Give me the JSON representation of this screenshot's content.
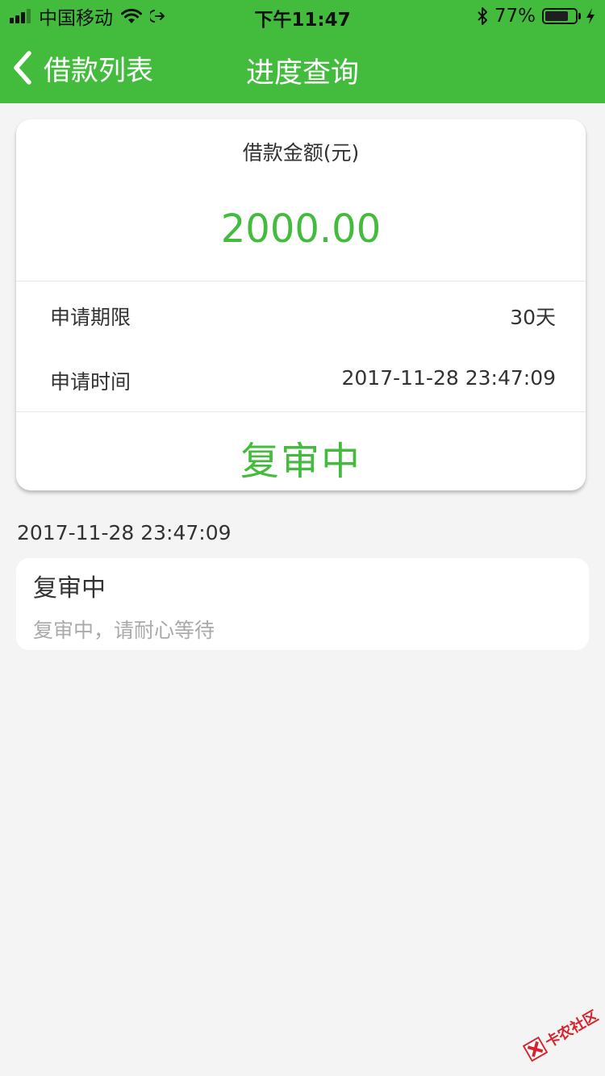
{
  "status_bar": {
    "carrier": "中国移动",
    "time": "下午11:47",
    "battery_percent": "77%",
    "battery_level": 0.77,
    "signal_bars_filled": 3,
    "signal_bars_total": 4,
    "icons": [
      "signal-icon",
      "wifi-icon",
      "location-arrow-icon",
      "bluetooth-icon",
      "battery-icon",
      "charging-bolt-icon"
    ]
  },
  "nav": {
    "back_label": "借款列表",
    "title": "进度查询",
    "back_icon": "chevron-left-icon"
  },
  "summary": {
    "amount_label": "借款金额(元)",
    "amount_value": "2000.00",
    "term_label": "申请期限",
    "term_value": "30天",
    "time_label": "申请时间",
    "time_value": "2017-11-28 23:47:09",
    "status": "复审中"
  },
  "timeline": [
    {
      "time": "2017-11-28 23:47:09",
      "title": "复审中",
      "description": "复审中，请耐心等待"
    }
  ],
  "watermark": {
    "text": "卡农社区"
  },
  "colors": {
    "brand_green": "#43bc3e",
    "background": "#f4f4f4",
    "card": "#ffffff",
    "text_primary": "#333333",
    "text_secondary": "#aaaaaa",
    "watermark_red": "#d9222a"
  }
}
